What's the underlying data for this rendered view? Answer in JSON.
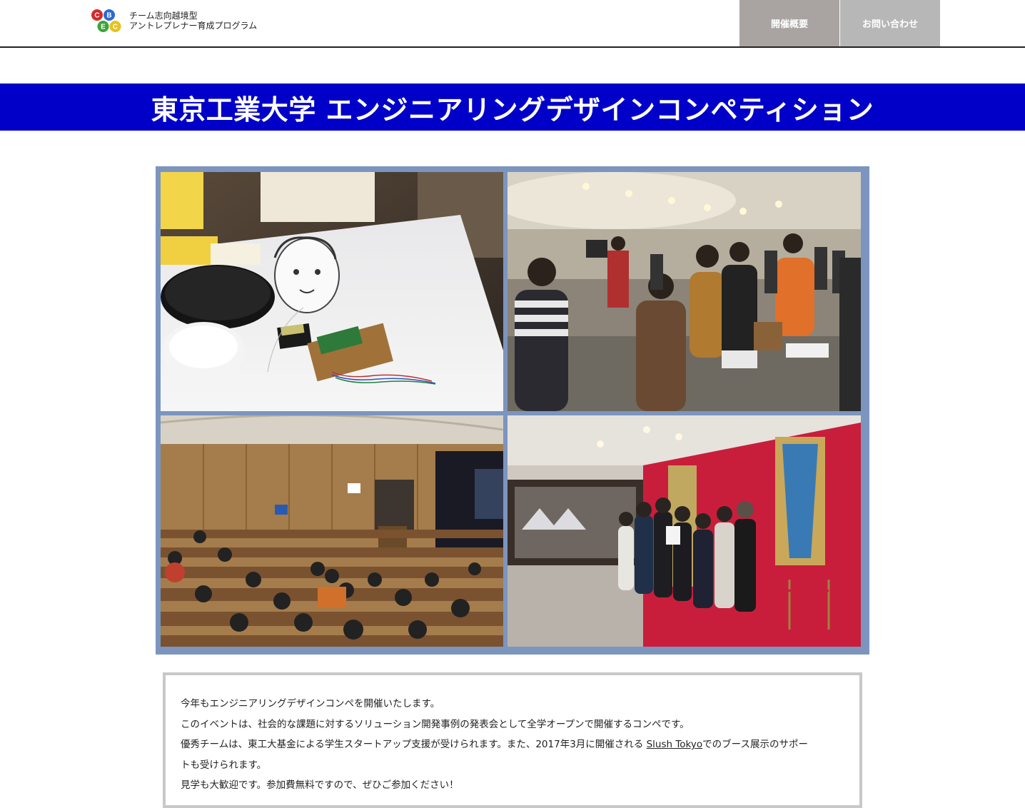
{
  "header": {
    "logo_letters": [
      "C",
      "B",
      "E",
      "C"
    ],
    "logo_text_line1": "チーム志向越境型",
    "logo_text_line2": "アントレプレナー育成プログラム",
    "nav_overview": "開催概要",
    "nav_contact": "お問い合わせ"
  },
  "banner": {
    "title": "東京工業大学 エンジニアリングデザインコンペティション",
    "color": "#0000c8"
  },
  "colors": {
    "collage_frame": "#7c95bf",
    "logo_red": "#d42a2a",
    "logo_blue": "#2a6bd4",
    "logo_green": "#3aa53a",
    "logo_yellow": "#e8c21a"
  },
  "photos": [
    {
      "name": "prototype-electronics-photo"
    },
    {
      "name": "exhibition-room-photo"
    },
    {
      "name": "lecture-hall-photo"
    },
    {
      "name": "award-group-photo"
    }
  ],
  "description": {
    "line1": "今年もエンジニアリングデザインコンペを開催いたします。",
    "line2": "このイベントは、社会的な課題に対するソリューション開発事例の発表会として全学オープンで開催するコンペです。",
    "line3_before": "優秀チームは、東工大基金による学生スタートアップ支援が受けられます。また、2017年3月に開催される ",
    "line3_link": "Slush Tokyo",
    "line3_after": "でのブース展示のサポー",
    "line4": "トも受けられます。",
    "line5": "見学も大歓迎です。参加費無料ですので、ぜひご参加ください！"
  }
}
